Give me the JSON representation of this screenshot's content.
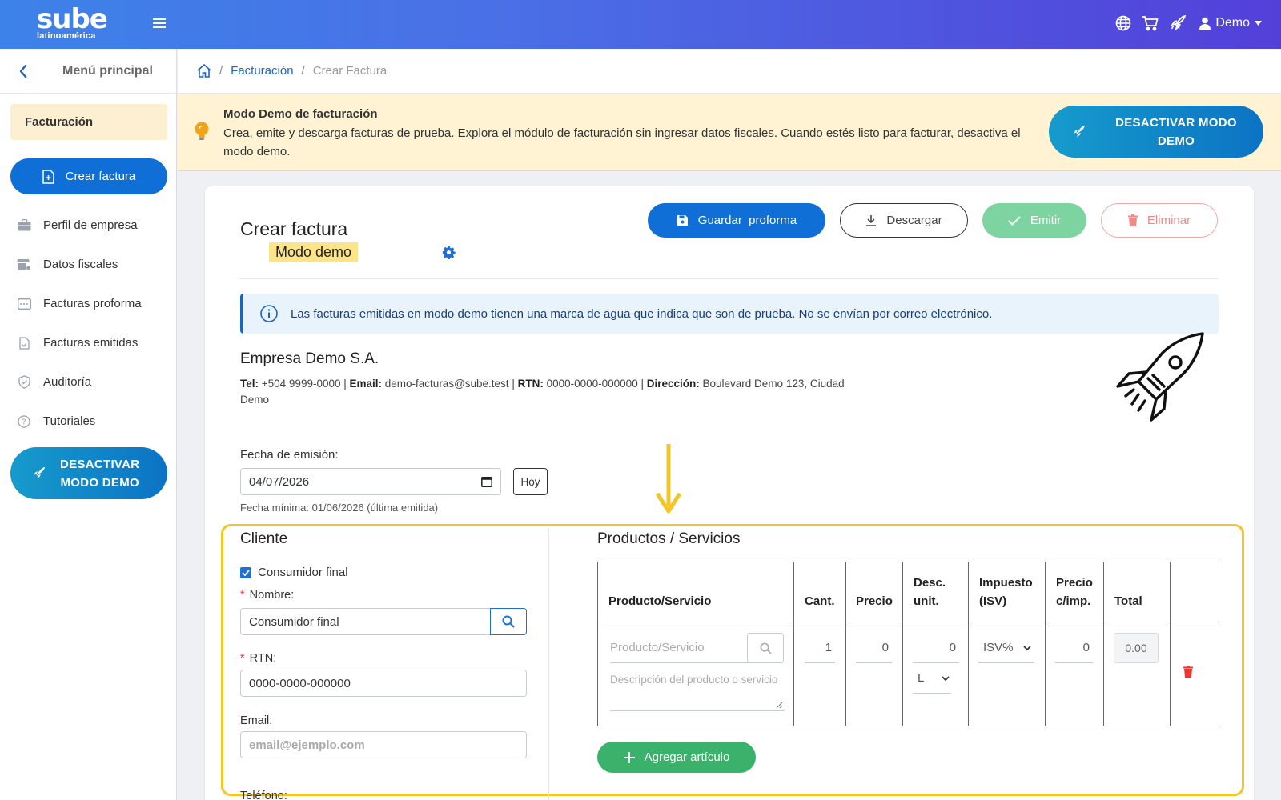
{
  "topbar": {
    "logo_main": "sube",
    "logo_sub": "latinoamérica",
    "user_label": "Demo",
    "icons": [
      "globe-icon",
      "cart-icon",
      "rocket-icon",
      "user-icon"
    ]
  },
  "sidebar": {
    "menu_title": "Menú principal",
    "section": "Facturación",
    "primary_action": "Crear factura",
    "items": [
      {
        "label": "Perfil de empresa",
        "icon": "briefcase-icon"
      },
      {
        "label": "Datos fiscales",
        "icon": "store-icon"
      },
      {
        "label": "Facturas proforma",
        "icon": "folder-icon"
      },
      {
        "label": "Facturas emitidas",
        "icon": "file-icon"
      },
      {
        "label": "Auditoría",
        "icon": "shield-icon"
      },
      {
        "label": "Tutoriales",
        "icon": "help-icon"
      }
    ],
    "demo_button_line1": "DESACTIVAR",
    "demo_button_line2": "MODO DEMO"
  },
  "breadcrumb": {
    "home_icon": "home-icon",
    "link": "Facturación",
    "current": "Crear Factura"
  },
  "banner": {
    "title": "Modo Demo de facturación",
    "text": "Crea, emite y descarga facturas de prueba. Explora el módulo de facturación sin ingresar datos fiscales. Cuando estés listo para facturar, desactiva el modo demo.",
    "button_line1": "DESACTIVAR MODO",
    "button_line2": "DEMO"
  },
  "invoice": {
    "title": "Crear factura",
    "badge": "Modo demo",
    "buttons": {
      "guardar": "Guardar  proforma",
      "descargar": "Descargar",
      "emitir": "Emitir",
      "eliminar": "Eliminar"
    },
    "info": "Las facturas emitidas en modo demo tienen una marca de agua que indica que son de prueba. No se envían por correo electrónico.",
    "company": {
      "name": "Empresa Demo S.A.",
      "tel_label": "Tel:",
      "tel": "+504 9999-0000",
      "email_label": "Email:",
      "email": "demo-facturas@sube.test",
      "rtn_label": "RTN:",
      "rtn": "0000-0000-000000",
      "dir_label": "Dirección:",
      "dir": "Boulevard Demo 123, Ciudad Demo"
    },
    "fecha": {
      "label": "Fecha de emisión:",
      "value": "04/07/2026",
      "hoy": "Hoy",
      "min": "Fecha mínima: 01/06/2026 (última emitida)"
    },
    "cliente": {
      "title": "Cliente",
      "checkbox": "Consumidor final",
      "checked": true,
      "nombre_label": "Nombre:",
      "nombre_value": "Consumidor final",
      "rtn_label": "RTN:",
      "rtn_value": "0000-0000-000000",
      "email_label": "Email:",
      "email_placeholder": "email@ejemplo.com",
      "telefono_label": "Teléfono:"
    },
    "productos": {
      "title": "Productos / Servicios",
      "headers": {
        "producto": "Producto/Servicio",
        "cant": "Cant.",
        "precio": "Precio",
        "desc1": "Desc.",
        "desc2": "unit.",
        "imp1": "Impuesto",
        "imp2": "(ISV)",
        "pci1": "Precio",
        "pci2": "c/imp.",
        "total": "Total"
      },
      "row": {
        "producto_placeholder": "Producto/Servicio",
        "descripcion_placeholder": "Descripción del producto o servicio",
        "cant": "1",
        "precio": "0",
        "desc": "0",
        "desc_tipo": "L",
        "impuesto": "ISV%",
        "precio_imp": "0",
        "total": "0.00"
      },
      "add_button": "Agregar artículo"
    }
  },
  "colors": {
    "primary": "#0f6fd6",
    "highlight": "#f2c628",
    "banner_bg": "#fff3d4",
    "success": "#3bb26c"
  }
}
